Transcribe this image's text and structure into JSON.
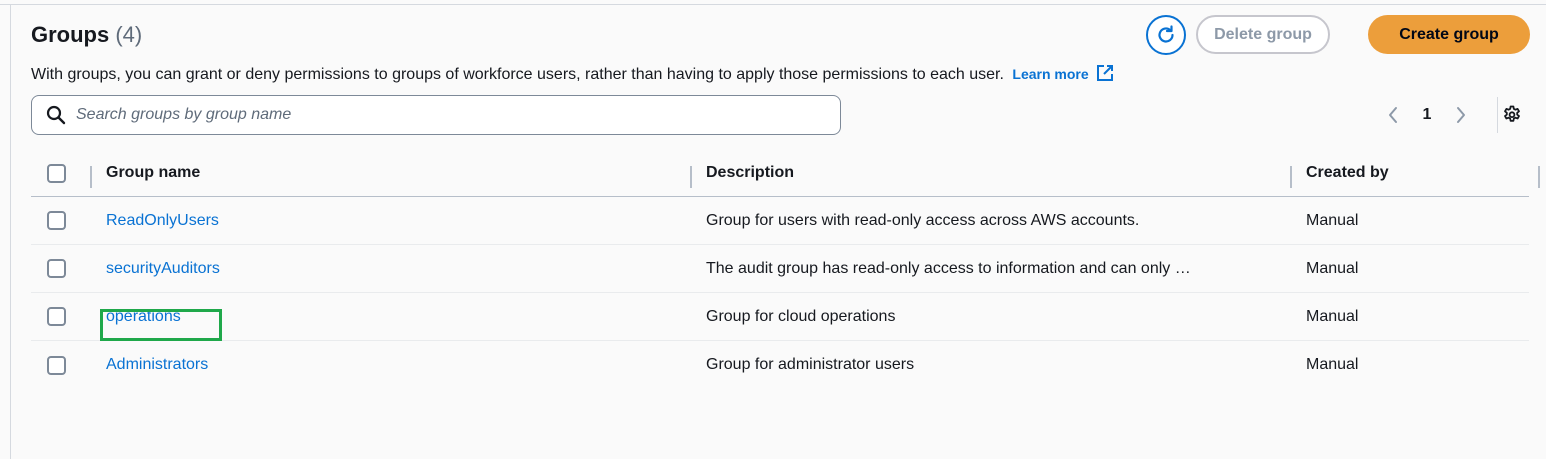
{
  "header": {
    "title": "Groups",
    "count": "(4)",
    "description": "With groups, you can grant or deny permissions to groups of workforce users, rather than having to apply those permissions to each user.",
    "learn_more": "Learn more"
  },
  "actions": {
    "refresh_icon": "refresh-icon",
    "delete_label": "Delete group",
    "create_label": "Create group"
  },
  "search": {
    "placeholder": "Search groups by group name"
  },
  "pagination": {
    "current_page": "1"
  },
  "table": {
    "columns": [
      "Group name",
      "Description",
      "Created by"
    ],
    "rows": [
      {
        "name": "ReadOnlyUsers",
        "description": "Group for users with read-only access across AWS accounts.",
        "created_by": "Manual"
      },
      {
        "name": "securityAuditors",
        "description": "The audit group has read-only access to information and can only …",
        "created_by": "Manual"
      },
      {
        "name": "operations",
        "description": "Group for cloud operations",
        "created_by": "Manual"
      },
      {
        "name": "Administrators",
        "description": "Group for administrator users",
        "created_by": "Manual"
      }
    ]
  },
  "colors": {
    "link": "#0972d3",
    "primary_button": "#ec9e3b",
    "highlight": "#1fa84a"
  }
}
